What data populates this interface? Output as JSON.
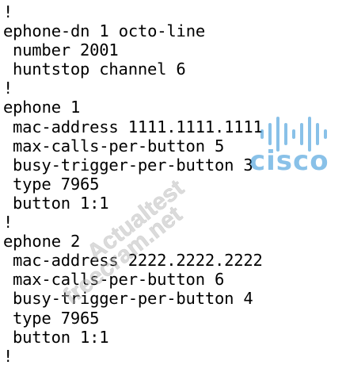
{
  "lines": [
    {
      "text": "!",
      "indent": false
    },
    {
      "text": "ephone-dn 1 octo-line",
      "indent": false
    },
    {
      "text": "number 2001",
      "indent": true
    },
    {
      "text": "huntstop channel 6",
      "indent": true
    },
    {
      "text": "!",
      "indent": false
    },
    {
      "text": "ephone 1",
      "indent": false
    },
    {
      "text": "mac-address 1111.1111.1111",
      "indent": true
    },
    {
      "text": "max-calls-per-button 5",
      "indent": true
    },
    {
      "text": "busy-trigger-per-button 3",
      "indent": true
    },
    {
      "text": "type 7965",
      "indent": true
    },
    {
      "text": "button 1:1",
      "indent": true
    },
    {
      "text": "!",
      "indent": false
    },
    {
      "text": "ephone 2",
      "indent": false
    },
    {
      "text": "mac-address 2222.2222.2222",
      "indent": true
    },
    {
      "text": "max-calls-per-button 6",
      "indent": true
    },
    {
      "text": "busy-trigger-per-button 4",
      "indent": true
    },
    {
      "text": "type 7965",
      "indent": true
    },
    {
      "text": "button 1:1",
      "indent": true
    },
    {
      "text": "!",
      "indent": false
    }
  ],
  "watermark": {
    "text_1": "Actualtest",
    "text_2": "freecram.net",
    "logo_text": "cisco",
    "color": "#2a8fd6",
    "text_color": "#b8b8b8"
  }
}
